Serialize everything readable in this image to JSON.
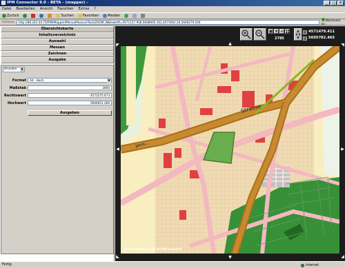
{
  "window": {
    "title": "IPM Connector 9.0 - BETA - (mapper) -"
  },
  "menubar": [
    "Datei",
    "Bearbeiten",
    "Ansicht",
    "Favoriten",
    "Extras",
    "?"
  ],
  "toolbar": {
    "back": "Zurück",
    "search": "Suchen",
    "favorites": "Favoriten",
    "media": "Medien"
  },
  "addressbar": {
    "label": "Adresse",
    "url": "http://88.243.44.75/IPM/Mapper/MenueMeasureToolsZOOM_IN&lowleft=4571157.958,5608005.162,4571602.26,5606279.504",
    "go": "Wechseln zu"
  },
  "nav": {
    "items": [
      "Übersichtskarte",
      "Inhaltsverzeichnis",
      "Auswahl",
      "Messen",
      "Zeichnen",
      "Ausgabe"
    ]
  },
  "ausgabe": {
    "mode": "Drucken",
    "format_label": "Format",
    "format_value": "A4 - Hoch",
    "massstab_label": "Maßstab",
    "massstab_value": "2800",
    "rechtswert_label": "Rechtswert",
    "rechtswert_value": "4571575.673",
    "hochwert_label": "Hochwert",
    "hochwert_value": "5606051.269",
    "ausgeben": "Ausgeben"
  },
  "map": {
    "coord_x": "4571479.411",
    "coord_y": "5605782.465",
    "scale": "2785",
    "credit": "IPM Connector, ESRI ArcIMS powered",
    "street_labels": [
      "Strasse",
      "Jenis..."
    ]
  },
  "statusbar": {
    "left": "Fertig",
    "zone": "Internet"
  }
}
